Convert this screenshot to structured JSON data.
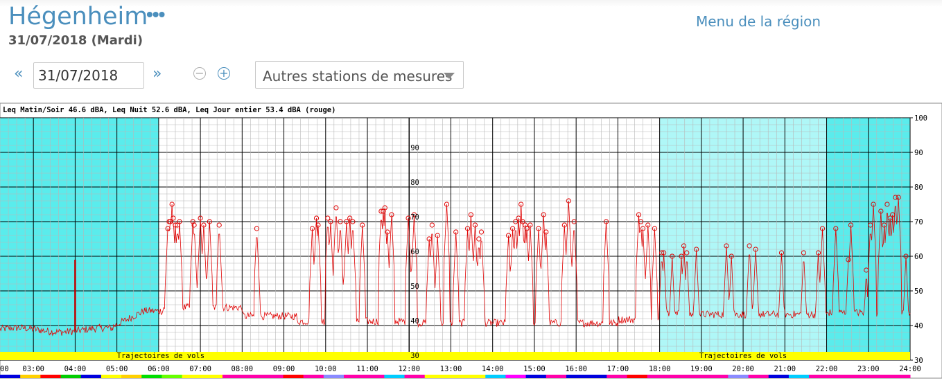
{
  "header": {
    "title": "Hégenheim",
    "more": "•••",
    "date_line": "31/07/2018 (Mardi)",
    "menu_link": "Menu de la région"
  },
  "controls": {
    "prev": "«",
    "next": "»",
    "date_value": "31/07/2018",
    "zoom_out": "−",
    "zoom_in": "+",
    "stations_select": "Autres stations de mesures"
  },
  "colors": {
    "night_band": "#5aecec",
    "dawn_band": "#aff7f7",
    "day_band": "#ffffff",
    "signal": "#e00000",
    "trajectory_band": "#ffff00"
  },
  "chart_data": {
    "type": "line",
    "title": "Leq Matin/Soir 46.6 dBA, Leq Nuit 52.6 dBA, Leq Jour entier 53.4 dBA (rouge)",
    "xlabel": "",
    "ylabel": "",
    "x_ticks": [
      "03:00",
      "04:00",
      "05:00",
      "06:00",
      "07:00",
      "08:00",
      "09:00",
      "10:00",
      "11:00",
      "12:00",
      "13:00",
      "14:00",
      "15:00",
      "16:00",
      "17:00",
      "18:00",
      "19:00",
      "20:00",
      "21:00",
      "22:00",
      "23:00",
      "24:00"
    ],
    "x_first_tick_fragment": "00",
    "xlim": [
      2.2,
      24
    ],
    "ylim": [
      30,
      100
    ],
    "y_ticks": [
      30,
      40,
      50,
      60,
      70,
      80,
      90,
      100
    ],
    "inner_y_labels": [
      30,
      40,
      50,
      60,
      70,
      80,
      90
    ],
    "grid": true,
    "bands": [
      {
        "from": 2.2,
        "to": 6.0,
        "kind": "night"
      },
      {
        "from": 6.0,
        "to": 18.0,
        "kind": "day"
      },
      {
        "from": 18.0,
        "to": 22.0,
        "kind": "evening"
      },
      {
        "from": 22.0,
        "to": 24.0,
        "kind": "night"
      }
    ],
    "trajectory_labels": [
      {
        "text": "Trajectoires de vols",
        "x": 5.0
      },
      {
        "text": "Trajectoires de vols",
        "x": 18.95
      }
    ],
    "events": [
      [
        6.22,
        68
      ],
      [
        6.25,
        70
      ],
      [
        6.28,
        70
      ],
      [
        6.32,
        75
      ],
      [
        6.35,
        71
      ],
      [
        6.4,
        69
      ],
      [
        6.45,
        69
      ],
      [
        6.5,
        70
      ],
      [
        6.82,
        70
      ],
      [
        6.85,
        69
      ],
      [
        7.0,
        71
      ],
      [
        7.08,
        69
      ],
      [
        7.22,
        70
      ],
      [
        7.45,
        69
      ],
      [
        8.35,
        68
      ],
      [
        9.68,
        68
      ],
      [
        9.78,
        71
      ],
      [
        9.82,
        69
      ],
      [
        10.05,
        71
      ],
      [
        10.12,
        70
      ],
      [
        10.25,
        74
      ],
      [
        10.35,
        70
      ],
      [
        10.5,
        70
      ],
      [
        10.58,
        71
      ],
      [
        10.65,
        70
      ],
      [
        10.88,
        69
      ],
      [
        11.33,
        73
      ],
      [
        11.38,
        73
      ],
      [
        11.42,
        74
      ],
      [
        11.48,
        67
      ],
      [
        11.58,
        72
      ],
      [
        11.98,
        71
      ],
      [
        12.12,
        72
      ],
      [
        12.48,
        65
      ],
      [
        12.55,
        69
      ],
      [
        12.68,
        66
      ],
      [
        12.9,
        75
      ],
      [
        13.12,
        67
      ],
      [
        13.4,
        68
      ],
      [
        13.48,
        72
      ],
      [
        13.58,
        69
      ],
      [
        13.67,
        65
      ],
      [
        13.73,
        67
      ],
      [
        14.38,
        66
      ],
      [
        14.48,
        68
      ],
      [
        14.55,
        70
      ],
      [
        14.62,
        71
      ],
      [
        14.68,
        75
      ],
      [
        14.72,
        70
      ],
      [
        14.78,
        69
      ],
      [
        14.82,
        68
      ],
      [
        14.9,
        69
      ],
      [
        15.1,
        68
      ],
      [
        15.22,
        72
      ],
      [
        15.28,
        67
      ],
      [
        15.72,
        69
      ],
      [
        15.82,
        76
      ],
      [
        15.95,
        70
      ],
      [
        16.72,
        70
      ],
      [
        17.5,
        72
      ],
      [
        17.55,
        70
      ],
      [
        17.6,
        68
      ],
      [
        17.72,
        69
      ],
      [
        17.88,
        68
      ],
      [
        18.05,
        61
      ],
      [
        18.1,
        61
      ],
      [
        18.3,
        60
      ],
      [
        18.52,
        60
      ],
      [
        18.58,
        63
      ],
      [
        18.65,
        61
      ],
      [
        18.88,
        62
      ],
      [
        19.6,
        63
      ],
      [
        19.72,
        60
      ],
      [
        20.15,
        63
      ],
      [
        20.3,
        62
      ],
      [
        20.92,
        61
      ],
      [
        21.45,
        61
      ],
      [
        21.8,
        61
      ],
      [
        21.9,
        68
      ],
      [
        22.22,
        68
      ],
      [
        22.52,
        59
      ],
      [
        22.58,
        69
      ],
      [
        22.95,
        56
      ],
      [
        23.05,
        69
      ],
      [
        23.12,
        75
      ],
      [
        23.3,
        73
      ],
      [
        23.38,
        69
      ],
      [
        23.45,
        75
      ],
      [
        23.52,
        71
      ],
      [
        23.58,
        72
      ],
      [
        23.65,
        77
      ],
      [
        23.72,
        77
      ],
      [
        23.9,
        60
      ]
    ],
    "spike": [
      4.0,
      59
    ]
  },
  "color_bar": [
    "#0000dd",
    "#ffd000",
    "#ff0000",
    "#00cc00",
    "#0000dd",
    "#ffff00",
    "#ffd000",
    "#00dd00",
    "#66ff00",
    "#ffff00",
    "#ffff00",
    "#ff00aa",
    "#ff00aa",
    "#ff00aa",
    "#ff0000",
    "#ff00aa",
    "#8a8aff",
    "#ff00aa",
    "#ff00aa",
    "#00ccff",
    "#ff00aa",
    "#ffff00",
    "#ffff00",
    "#ffff00",
    "#00ccff",
    "#ff00ff",
    "#0000dd",
    "#ff00aa",
    "#0000dd",
    "#0000dd",
    "#ff00aa",
    "#ff0000",
    "#ff00aa",
    "#ff00aa",
    "#ff00aa",
    "#ff00aa",
    "#8a8aff",
    "#ff00aa",
    "#0000dd",
    "#00ccff",
    "#ff00aa",
    "#ff00aa",
    "#ff00aa",
    "#ff00aa",
    "#ff00aa"
  ]
}
